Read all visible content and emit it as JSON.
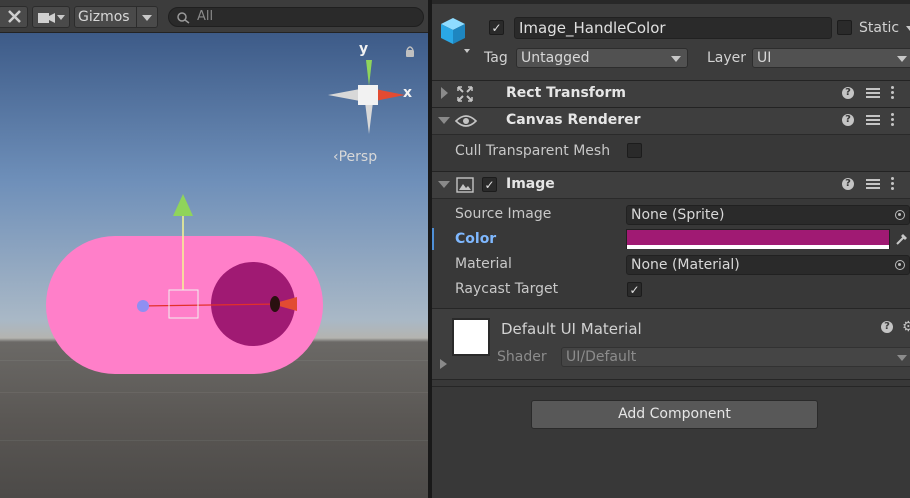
{
  "scene": {
    "gizmos_label": "Gizmos",
    "search_placeholder": "All",
    "axis_y": "y",
    "axis_x": "x",
    "persp_label": "‹Persp",
    "handle_color": "#ff7fc9",
    "knob_color": "#a01a73"
  },
  "inspector": {
    "object_name": "Image_HandleColor",
    "static_label": "Static",
    "tag_label": "Tag",
    "tag_value": "Untagged",
    "layer_label": "Layer",
    "layer_value": "UI",
    "components": {
      "rect_transform": {
        "title": "Rect Transform"
      },
      "canvas_renderer": {
        "title": "Canvas Renderer",
        "cull_label": "Cull Transparent Mesh"
      },
      "image": {
        "title": "Image",
        "source_image_label": "Source Image",
        "source_image_value": "None (Sprite)",
        "color_label": "Color",
        "color_value": "#a01a73",
        "material_label": "Material",
        "material_value": "None (Material)",
        "raycast_label": "Raycast Target"
      }
    },
    "material_preview": {
      "title": "Default UI Material",
      "shader_label": "Shader",
      "shader_value": "UI/Default"
    },
    "add_component_label": "Add Component",
    "help_glyph": "?"
  }
}
